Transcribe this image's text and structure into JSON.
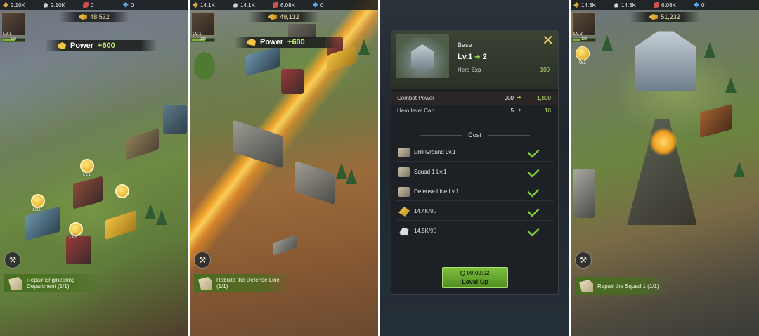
{
  "panels": [
    {
      "resources": [
        "2.10K",
        "2.10K",
        "0",
        "0"
      ],
      "gold": "48,532",
      "avatar": {
        "level": "Lv.1",
        "xp": "120",
        "xp_fill": 0.55
      },
      "power": {
        "label": "Power",
        "gain": "+600"
      },
      "bubbles": [
        "Lv.1",
        "120K",
        "1.8K"
      ],
      "quest": "Repair Engineering Department (1/1)"
    },
    {
      "resources": [
        "14.1K",
        "14.1K",
        "6.08K",
        "0"
      ],
      "gold": "49,132",
      "avatar": {
        "level": "Lv.1",
        "xp": "120",
        "xp_fill": 0.55
      },
      "power": {
        "label": "Power",
        "gain": "+600"
      },
      "quest": "Rebuild the Defense Line (1/1)"
    },
    {
      "dialog": {
        "building_name": "Base",
        "level_from": "Lv.1",
        "level_to": "2",
        "hero_exp_label": "Hero Exp",
        "hero_exp_value": "100",
        "stats": [
          {
            "label": "Combat Power",
            "from": "900",
            "to": "1,800"
          },
          {
            "label": "Hero level Cap",
            "from": "5",
            "to": "10"
          }
        ],
        "cost_title": "Cost",
        "costs": [
          {
            "icon": "drill-ground-icon",
            "text": "Drill Ground Lv.1",
            "need": ""
          },
          {
            "icon": "squad-icon",
            "text": "Squad 1 Lv.1",
            "need": ""
          },
          {
            "icon": "defense-line-icon",
            "text": "Defense Line Lv.1",
            "need": ""
          },
          {
            "icon": "wheat-icon",
            "text": "14.4K",
            "need": "/90"
          },
          {
            "icon": "ore-icon",
            "text": "14.5K",
            "need": "/90"
          }
        ],
        "timer": "00:00:02",
        "level_up_label": "Level Up"
      }
    },
    {
      "resources": [
        "14.3K",
        "14.3K",
        "6.08K",
        "0"
      ],
      "gold": "51,232",
      "avatar": {
        "level": "Lv.2",
        "xp": "120",
        "xp_fill": 0.3
      },
      "badge": "0/1",
      "quest": "Repair the Squad 1 (1/1)"
    }
  ],
  "colors": {
    "accent_green": "#7fbf3e",
    "gold": "#f1c643",
    "plus_green": "#b9f06b"
  }
}
